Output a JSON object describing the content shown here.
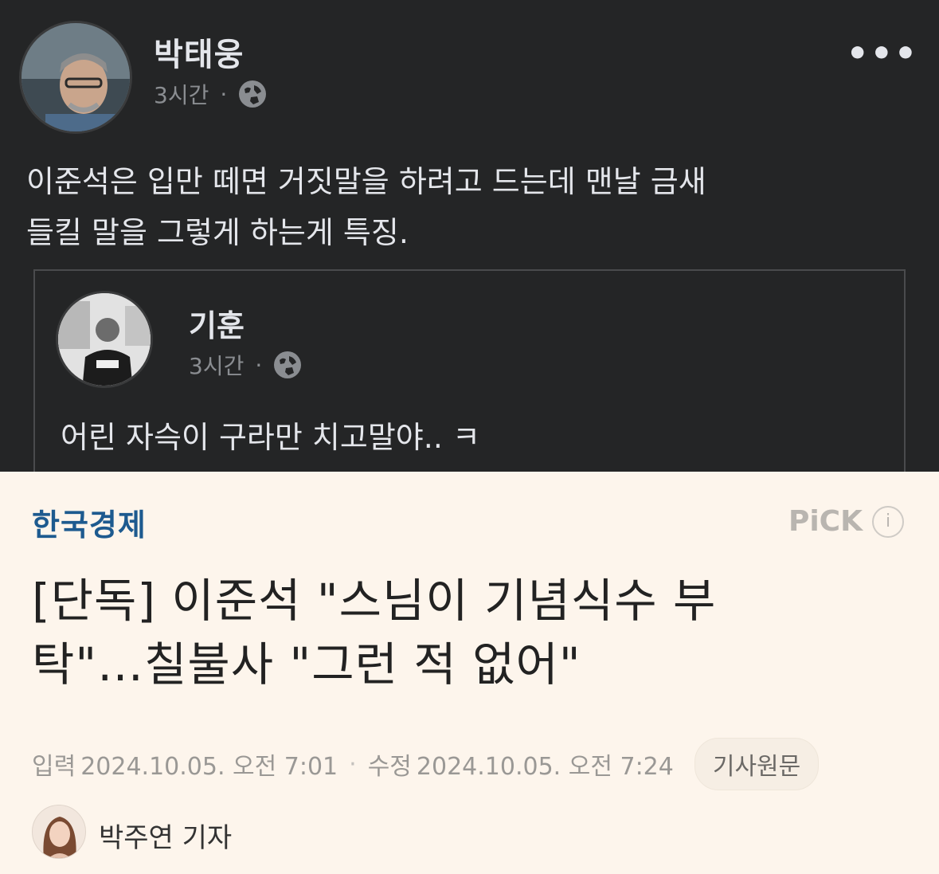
{
  "post": {
    "author": "박태웅",
    "time": "3시간",
    "separator": "·",
    "more_label": "•••",
    "text_line1": "이준석은 입만 떼면 거짓말을 하려고 드는데 맨날 금새",
    "text_line2": "들킬 말을 그렇게 하는게 특징."
  },
  "shared_post": {
    "author": "기훈",
    "time": "3시간",
    "separator": "·",
    "text": "어린 자슥이 구라만 치고말야.. ㅋ"
  },
  "article": {
    "press": "한국경제",
    "pick_label": "PiCK",
    "info_icon": "i",
    "headline_line1": "[단독] 이준석 \"스님이 기념식수 부",
    "headline_line2": "탁\"…칠불사 \"그런 적 없어\"",
    "input_label": "입력",
    "input_date": "2024.10.05. 오전 7:01",
    "date_separator": "·",
    "modified_label": "수정",
    "modified_date": "2024.10.05. 오전 7:24",
    "original_button": "기사원문",
    "reporter": "박주연 기자"
  },
  "colors": {
    "post_bg": "#242526",
    "article_bg": "#fdf5ec",
    "press_blue": "#1d5a8f"
  },
  "icons": {
    "globe": "globe-icon",
    "more": "more-icon",
    "info": "info-icon"
  }
}
